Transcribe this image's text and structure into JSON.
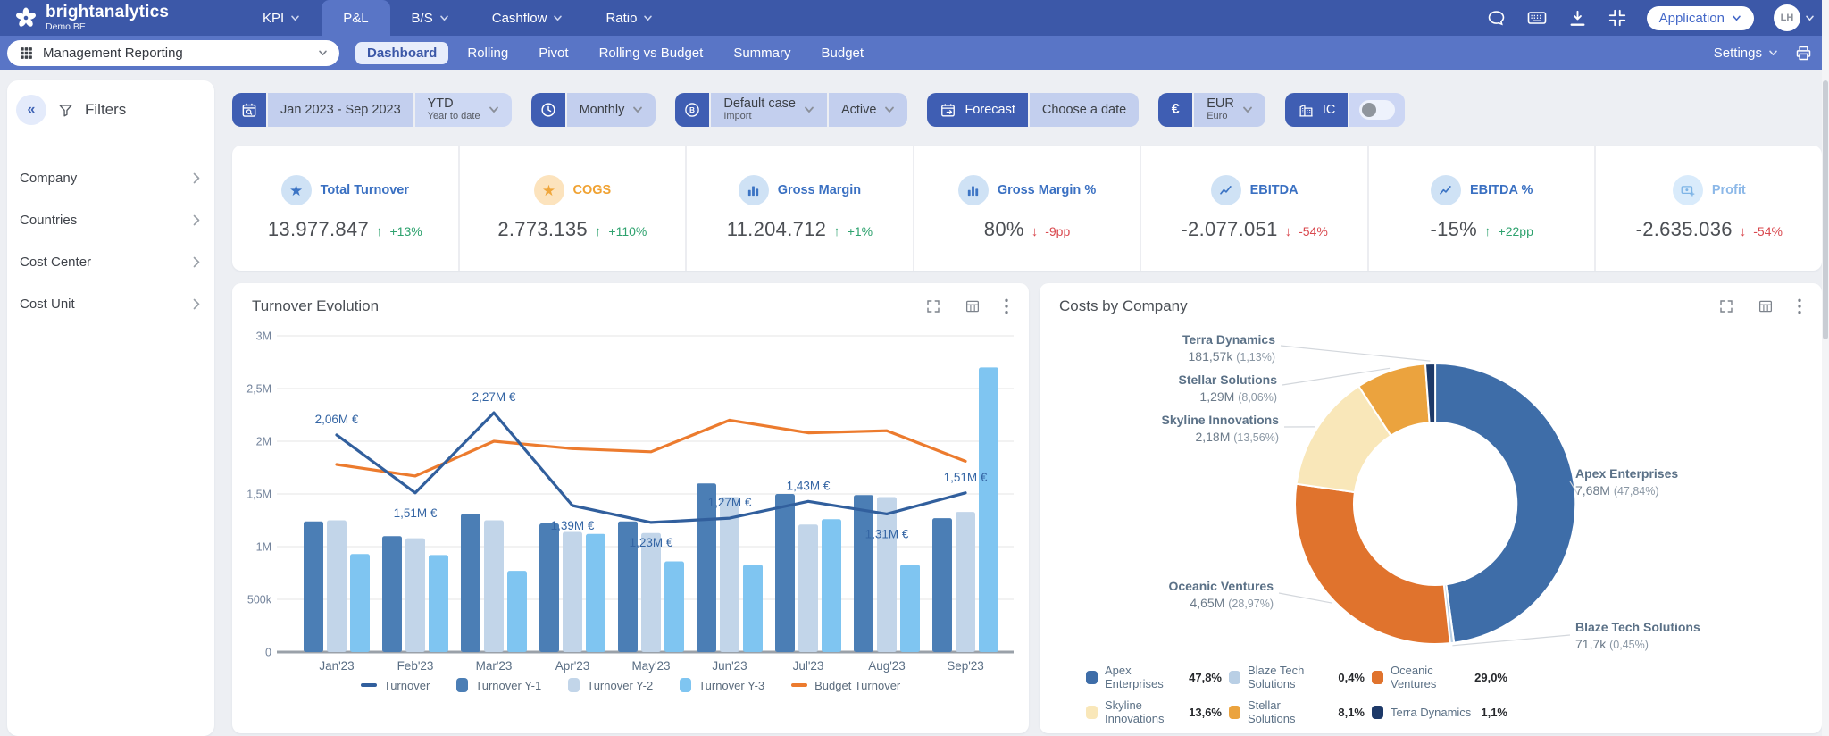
{
  "colors": {
    "topbar": "#3c58a8",
    "subbar": "#5975c6",
    "accent_dark_chip": "#3f5eb3",
    "chip_light": "#c3cfee",
    "positive": "#2ea26e",
    "negative": "#d9484e",
    "kpi_label_blue": "#3a70c2",
    "kpi_label_orange": "#f0a232"
  },
  "topbar": {
    "brand": "brightanalytics",
    "environment": "Demo BE",
    "nav": [
      {
        "label": "KPI",
        "chevron": true,
        "active": false
      },
      {
        "label": "P&L",
        "chevron": false,
        "active": true
      },
      {
        "label": "B/S",
        "chevron": true,
        "active": false
      },
      {
        "label": "Cashflow",
        "chevron": true,
        "active": false
      },
      {
        "label": "Ratio",
        "chevron": true,
        "active": false
      }
    ],
    "application_button": "Application",
    "avatar_initials": "LH"
  },
  "subbar": {
    "workspace": "Management Reporting",
    "tabs": [
      "Dashboard",
      "Rolling",
      "Pivot",
      "Rolling vs Budget",
      "Summary",
      "Budget"
    ],
    "active_tab": "Dashboard",
    "settings_label": "Settings"
  },
  "sidebar": {
    "title": "Filters",
    "items": [
      "Company",
      "Countries",
      "Cost Center",
      "Cost Unit"
    ]
  },
  "toolbar": {
    "date_range": "Jan 2023 - Sep 2023",
    "ytd_label": "YTD",
    "ytd_sub": "Year to date",
    "granularity": "Monthly",
    "case_label": "Default case",
    "case_sub": "Import",
    "status": "Active",
    "forecast_label": "Forecast",
    "choose_date_label": "Choose a date",
    "currency_code": "EUR",
    "currency_name": "Euro",
    "ic_label": "IC",
    "ic_toggle_on": false
  },
  "kpis": [
    {
      "label": "Total Turnover",
      "value": "13.977.847",
      "delta": "+13%",
      "dir": "up",
      "icon": "star",
      "theme": "blue"
    },
    {
      "label": "COGS",
      "value": "2.773.135",
      "delta": "+110%",
      "dir": "up",
      "icon": "star",
      "theme": "orange"
    },
    {
      "label": "Gross Margin",
      "value": "11.204.712",
      "delta": "+1%",
      "dir": "up",
      "icon": "bars",
      "theme": "blue"
    },
    {
      "label": "Gross Margin %",
      "value": "80%",
      "delta": "-9pp",
      "dir": "down",
      "icon": "bars",
      "theme": "blue"
    },
    {
      "label": "EBITDA",
      "value": "-2.077.051",
      "delta": "-54%",
      "dir": "down",
      "icon": "line",
      "theme": "blue"
    },
    {
      "label": "EBITDA %",
      "value": "-15%",
      "delta": "+22pp",
      "dir": "up",
      "icon": "line",
      "theme": "blue"
    },
    {
      "label": "Profit",
      "value": "-2.635.036",
      "delta": "-54%",
      "dir": "down",
      "icon": "money",
      "theme": "lightblue"
    }
  ],
  "chart_data": [
    {
      "type": "bar+line",
      "title": "Turnover Evolution",
      "categories": [
        "Jan'23",
        "Feb'23",
        "Mar'23",
        "Apr'23",
        "May'23",
        "Jun'23",
        "Jul'23",
        "Aug'23",
        "Sep'23"
      ],
      "ylim": [
        0,
        3000000
      ],
      "y_ticks": [
        [
          "3M",
          3000000
        ],
        [
          "2,5M",
          2500000
        ],
        [
          "2M",
          2000000
        ],
        [
          "1,5M",
          1500000
        ],
        [
          "1M",
          1000000
        ],
        [
          "500k",
          500000
        ],
        [
          "0",
          0
        ]
      ],
      "bar_series": [
        {
          "name": "Turnover Y-1",
          "color": "#4b7eb5",
          "values": [
            1240000,
            1100000,
            1310000,
            1220000,
            1240000,
            1600000,
            1500000,
            1490000,
            1270000
          ]
        },
        {
          "name": "Turnover Y-2",
          "color": "#c2d5e9",
          "values": [
            1250000,
            1080000,
            1250000,
            1140000,
            1130000,
            1470000,
            1210000,
            1470000,
            1330000
          ]
        },
        {
          "name": "Turnover Y-3",
          "color": "#7fc5f1",
          "values": [
            930000,
            920000,
            770000,
            1120000,
            860000,
            830000,
            1260000,
            830000,
            2700000
          ]
        }
      ],
      "line_series": [
        {
          "name": "Budget Turnover",
          "color": "#ec7b2e",
          "values": [
            1780000,
            1670000,
            2000000,
            1930000,
            1900000,
            2200000,
            2080000,
            2100000,
            1810000
          ]
        },
        {
          "name": "Turnover",
          "color": "#315f9d",
          "values": [
            2060000,
            1510000,
            2270000,
            1390000,
            1230000,
            1270000,
            1430000,
            1310000,
            1510000
          ],
          "labels": [
            "2,06M €",
            "1,51M €",
            "2,27M €",
            "1,39M €",
            "1,23M €",
            "1,27M €",
            "1,43M €",
            "1,31M €",
            "1,51M €"
          ],
          "label_below": [
            false,
            true,
            false,
            true,
            true,
            false,
            false,
            true,
            false
          ]
        }
      ],
      "legend": [
        "Turnover",
        "Turnover Y-1",
        "Turnover Y-2",
        "Turnover Y-3",
        "Budget Turnover"
      ]
    },
    {
      "type": "donut",
      "title": "Costs by Company",
      "slices": [
        {
          "label": "Apex Enterprises",
          "value_label": "7,68M",
          "pct_label": "(47,84%)",
          "pct": 47.84,
          "color": "#3e6da8"
        },
        {
          "label": "Blaze Tech Solutions",
          "value_label": "71,7k",
          "pct_label": "(0,45%)",
          "pct": 0.45,
          "color": "#b9cfe5"
        },
        {
          "label": "Oceanic Ventures",
          "value_label": "4,65M",
          "pct_label": "(28,97%)",
          "pct": 28.97,
          "color": "#e0732d"
        },
        {
          "label": "Skyline Innovations",
          "value_label": "2,18M",
          "pct_label": "(13,56%)",
          "pct": 13.56,
          "color": "#f9e7b9"
        },
        {
          "label": "Stellar Solutions",
          "value_label": "1,29M",
          "pct_label": "(8,06%)",
          "pct": 8.06,
          "color": "#eba33e"
        },
        {
          "label": "Terra Dynamics",
          "value_label": "181,57k",
          "pct_label": "(1,13%)",
          "pct": 1.13,
          "color": "#1d3968"
        }
      ],
      "legend": [
        {
          "label": "Apex Enterprises",
          "pct": "47,8%",
          "color": "#3e6da8"
        },
        {
          "label": "Blaze Tech Solutions",
          "pct": "0,4%",
          "color": "#b9cfe5"
        },
        {
          "label": "Oceanic Ventures",
          "pct": "29,0%",
          "color": "#e0732d"
        },
        {
          "label": "Skyline Innovations",
          "pct": "13,6%",
          "color": "#f9e7b9"
        },
        {
          "label": "Stellar Solutions",
          "pct": "8,1%",
          "color": "#eba33e"
        },
        {
          "label": "Terra Dynamics",
          "pct": "1,1%",
          "color": "#1d3968"
        }
      ]
    }
  ]
}
